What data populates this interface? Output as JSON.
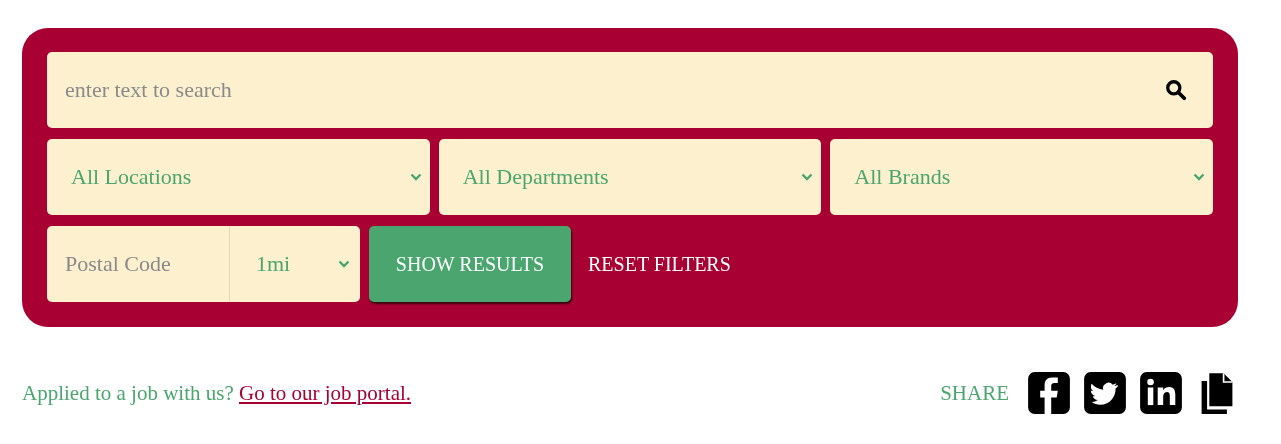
{
  "search": {
    "placeholder": "enter text to search"
  },
  "filters": [
    {
      "label": "All Locations"
    },
    {
      "label": "All Departments"
    },
    {
      "label": "All Brands"
    }
  ],
  "postal_code": {
    "placeholder": "Postal Code"
  },
  "distance": {
    "value": "1mi"
  },
  "show_results": "SHOW RESULTS",
  "reset_filters": "RESET FILTERS",
  "footer": {
    "question": "Applied to a job with us?",
    "link": "Go to our job portal.",
    "share_label": "SHARE",
    "share_icons": [
      {
        "kind": "facebook"
      },
      {
        "kind": "twitter"
      },
      {
        "kind": "linkedin"
      },
      {
        "kind": "copy"
      }
    ]
  }
}
